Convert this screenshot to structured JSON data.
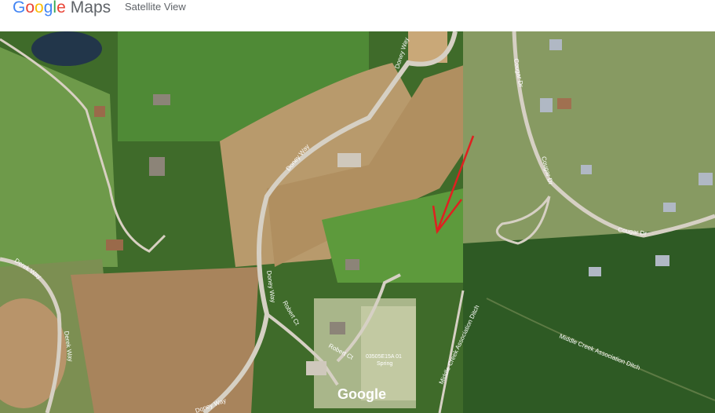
{
  "header": {
    "logo_text": "Google",
    "logo_suffix": "Maps",
    "view_label": "Satellite View"
  },
  "map": {
    "type": "satellite",
    "road_labels": {
      "doney_way_top": "Doney Way",
      "doney_way_mid": "Doney Way",
      "doney_way_lower": "Doney Way",
      "doney_way_bottom": "Doney Way",
      "derek_way_upper": "Derek Way",
      "derek_way_lower": "Derek Way",
      "robert_ct_1": "Robert Ct",
      "robert_ct_2": "Robert Ct",
      "cougar_dr_1": "Cougar Dr",
      "cougar_dr_2": "Cougar Dr",
      "cougar_dr_3": "Cougar Dr",
      "middle_creek_1": "Middle Creek Association Ditch",
      "middle_creek_2": "Middle Creek Association Ditch"
    },
    "parcel_label_1": "03505E15A 01",
    "parcel_label_2": "Spring",
    "watermark": "Google",
    "annotation": "red-arrow",
    "arrow_color": "#e02020"
  }
}
